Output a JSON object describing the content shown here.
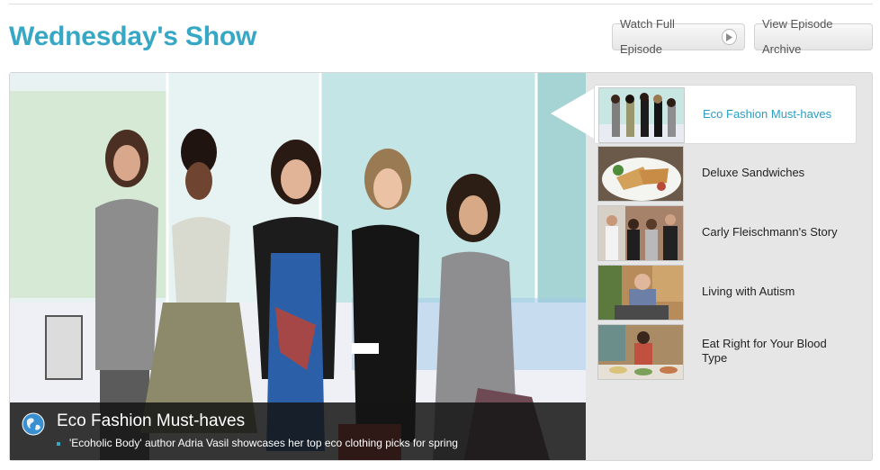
{
  "header": {
    "title": "Wednesday's Show",
    "watch_label": "Watch Full Episode",
    "archive_label": "View Episode Archive"
  },
  "feature": {
    "title": "Eco Fashion Must-haves",
    "description": "'Ecoholic Body' author Adria Vasil showcases her top eco clothing picks for spring"
  },
  "segments": [
    {
      "label": "Eco Fashion Must-haves",
      "active": true
    },
    {
      "label": "Deluxe Sandwiches",
      "active": false
    },
    {
      "label": "Carly Fleischmann's Story",
      "active": false
    },
    {
      "label": "Living with Autism",
      "active": false
    },
    {
      "label": "Eat Right for Your Blood Type",
      "active": false
    }
  ],
  "colors": {
    "accent": "#36a8c6",
    "active_label": "#2b9fc2",
    "caption_bg": "#141414"
  },
  "icons": {
    "play": "play-icon",
    "globe": "globe-icon"
  }
}
